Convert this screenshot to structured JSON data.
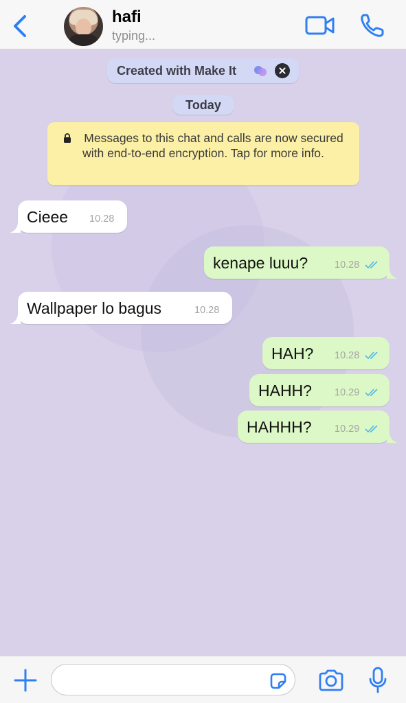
{
  "header": {
    "contact_name": "hafi",
    "status": "typing...",
    "accent_color": "#2f7ff3"
  },
  "banners": {
    "makeit_label": "Created with Make It",
    "date_label": "Today",
    "encryption_notice": "Messages to this chat and calls are now secured with end-to-end encryption. Tap for more info."
  },
  "messages": [
    {
      "direction": "incoming",
      "text": "Cieee",
      "time": "10.28"
    },
    {
      "direction": "outgoing",
      "text": "kenape luuu?",
      "time": "10.28",
      "read": true
    },
    {
      "direction": "incoming",
      "text": "Wallpaper lo bagus",
      "time": "10.28"
    },
    {
      "direction": "outgoing",
      "text": "HAH?",
      "time": "10.28",
      "read": true
    },
    {
      "direction": "outgoing",
      "text": "HAHH?",
      "time": "10.29",
      "read": true
    },
    {
      "direction": "outgoing",
      "text": "HAHHH?",
      "time": "10.29",
      "read": true
    }
  ],
  "composer": {
    "value": "",
    "placeholder": ""
  },
  "icons": [
    "back-chevron-icon",
    "video-call-icon",
    "phone-call-icon",
    "lock-icon",
    "make-it-logo-icon",
    "close-icon",
    "read-ticks-icon",
    "plus-icon",
    "sticker-icon",
    "camera-icon",
    "microphone-icon"
  ],
  "colors": {
    "chat_background": "#d8d1e9",
    "incoming_bubble": "#ffffff",
    "outgoing_bubble": "#dcf8c6",
    "encryption_banner": "#fcefa6",
    "read_ticks": "#4fb6ec"
  }
}
